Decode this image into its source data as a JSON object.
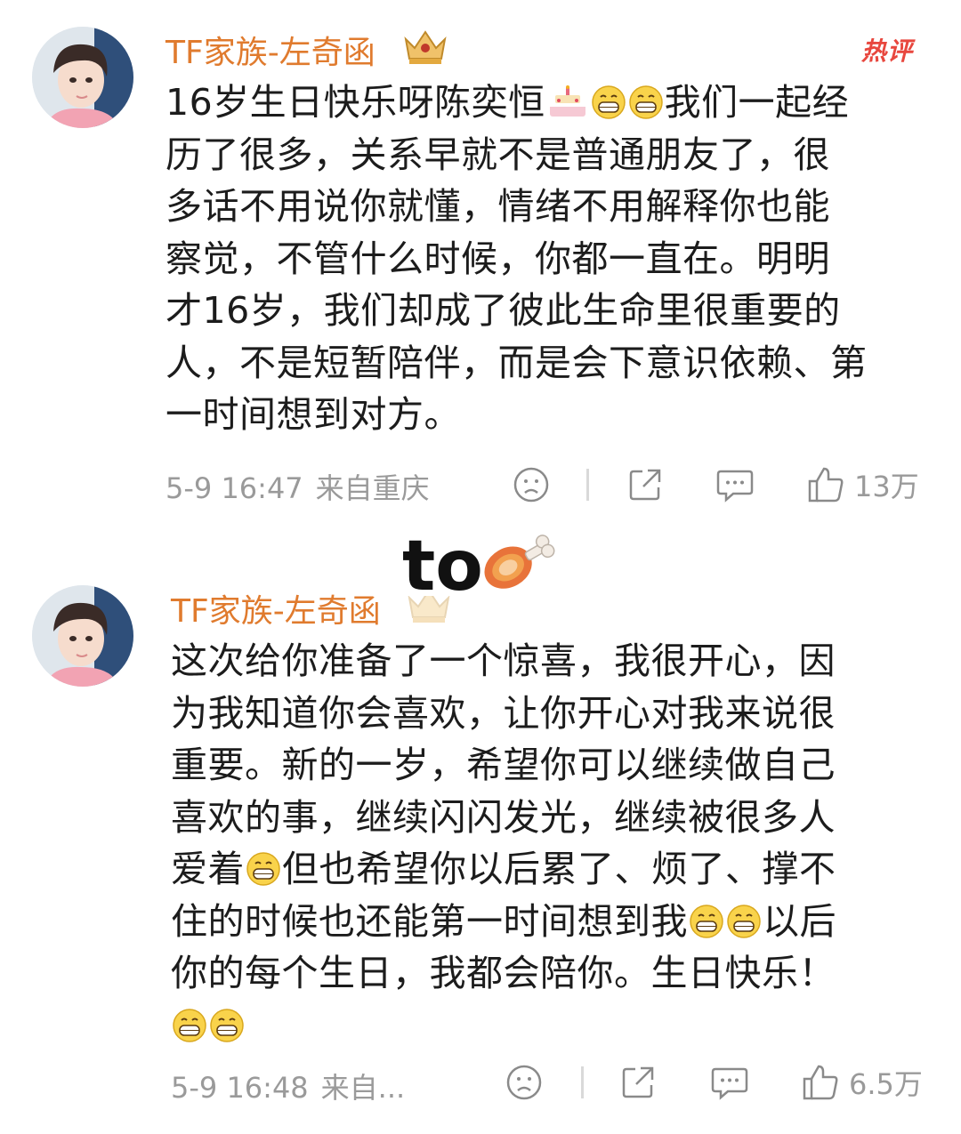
{
  "comments": [
    {
      "username": "TF家族-左奇函",
      "hot_badge": "热评",
      "lines": [
        [
          "16岁生日快乐呀陈奕恒",
          "cake",
          "grin",
          "grin",
          "我们一起经"
        ],
        [
          "历了很多，关系早就不是普通朋友了，很"
        ],
        [
          "多话不用说你就懂，情绪不用解释你也能"
        ],
        [
          "察觉，不管什么时候，你都一直在。明明"
        ],
        [
          "才16岁，我们却成了彼此生命里很重要的"
        ],
        [
          "人，不是短暂陪伴，而是会下意识依赖、第"
        ],
        [
          "一时间想到对方。"
        ]
      ],
      "time": "5-9 16:47",
      "location": "来自重庆",
      "likes": "13万"
    },
    {
      "username": "TF家族-左奇函",
      "lines": [
        [
          "这次给你准备了一个惊喜，我很开心，因"
        ],
        [
          "为我知道你会喜欢，让你开心对我来说很"
        ],
        [
          "重要。新的一岁，希望你可以继续做自己"
        ],
        [
          "喜欢的事，继续闪闪发光，继续被很多人"
        ],
        [
          "爱着",
          "grin",
          "但也希望你以后累了、烦了、撑不"
        ],
        [
          "住的时候也还能第一时间想到我",
          "grin",
          "grin",
          "以后"
        ],
        [
          "你的每个生日，我都会陪你。生日快乐！"
        ],
        [
          "grin",
          "grin"
        ]
      ],
      "time": "5-9 16:48",
      "location": "来自...",
      "likes": "6.5万"
    }
  ],
  "overlay": {
    "text": "to",
    "icon": "meat-on-bone-emoji"
  },
  "icons": {
    "dislike": "sad-face-icon",
    "share": "share-icon",
    "comment": "comment-bubble-icon",
    "like": "thumbs-up-icon",
    "crown": "crown-badge-icon"
  },
  "colors": {
    "username": "#e07b2e",
    "hot_badge": "#e8473e",
    "meta": "#9a9a9a"
  }
}
